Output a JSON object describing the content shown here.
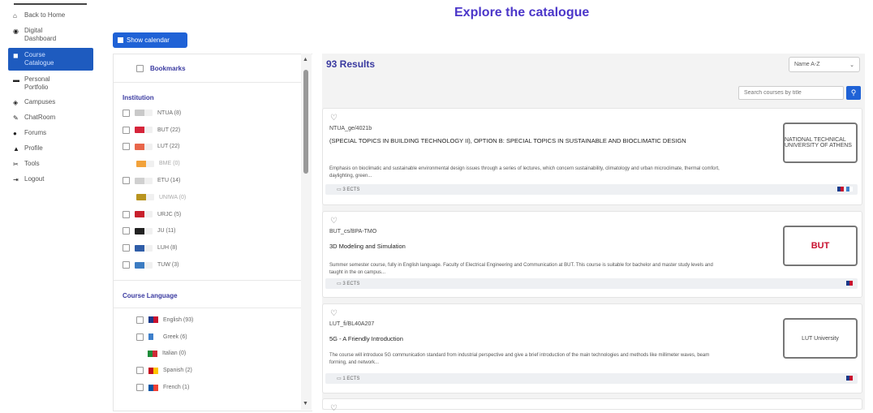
{
  "sidebar": {
    "items": [
      {
        "icon": "home-icon",
        "glyph": "⌂",
        "label": "Back to Home"
      },
      {
        "icon": "dashboard-icon",
        "glyph": "◉",
        "label": "Digital Dashboard"
      },
      {
        "icon": "catalogue-icon",
        "glyph": "◼",
        "label": "Course Catalogue"
      },
      {
        "icon": "portfolio-icon",
        "glyph": "▬",
        "label": "Personal Portfolio"
      },
      {
        "icon": "campuses-icon",
        "glyph": "◈",
        "label": "Campuses"
      },
      {
        "icon": "chatroom-icon",
        "glyph": "✎",
        "label": "ChatRoom"
      },
      {
        "icon": "forums-icon",
        "glyph": "●",
        "label": "Forums"
      },
      {
        "icon": "profile-icon",
        "glyph": "▲",
        "label": "Profile"
      },
      {
        "icon": "tools-icon",
        "glyph": "✂",
        "label": "Tools"
      },
      {
        "icon": "logout-icon",
        "glyph": "⇥",
        "label": "Logout"
      }
    ]
  },
  "page": {
    "title": "Explore the catalogue"
  },
  "calendar_button": "Show calendar",
  "filters": {
    "bookmarks_label": "Bookmarks",
    "institution_heading": "Institution",
    "institutions": [
      {
        "label": "NTUA (8)",
        "color": "#c9c9c9",
        "checkbox": true
      },
      {
        "label": "BUT (22)",
        "color": "#d6243a",
        "checkbox": true
      },
      {
        "label": "LUT (22)",
        "color": "#e8664a",
        "checkbox": true
      },
      {
        "label": "BME (0)",
        "color": "#f2a23b",
        "checkbox": false
      },
      {
        "label": "ETU (14)",
        "color": "#d0d0d0",
        "checkbox": true
      },
      {
        "label": "UNIWA (0)",
        "color": "#b8941f",
        "checkbox": false
      },
      {
        "label": "URJC (5)",
        "color": "#c8202c",
        "checkbox": true
      },
      {
        "label": "JU (11)",
        "color": "#222222",
        "checkbox": true
      },
      {
        "label": "LUH (8)",
        "color": "#2f5da8",
        "checkbox": true
      },
      {
        "label": "TUW (3)",
        "color": "#3c7cc2",
        "checkbox": true
      }
    ],
    "language_heading": "Course Language",
    "languages": [
      {
        "label": "English (93)",
        "colors": [
          "#1a3a8a",
          "#c8102e"
        ],
        "checkbox": true
      },
      {
        "label": "Greek (6)",
        "colors": [
          "#3d7fcb",
          "#ffffff"
        ],
        "checkbox": true
      },
      {
        "label": "Italian (0)",
        "colors": [
          "#1e8c3a",
          "#ce2b37"
        ],
        "checkbox": false
      },
      {
        "label": "Spanish (2)",
        "colors": [
          "#c60b1e",
          "#ffc400"
        ],
        "checkbox": true
      },
      {
        "label": "French (1)",
        "colors": [
          "#0055a4",
          "#ef4135"
        ],
        "checkbox": true
      }
    ]
  },
  "results": {
    "count_label": "93 Results",
    "sort_value": "Name A-Z",
    "search_placeholder": "Search courses by title"
  },
  "courses": [
    {
      "code": "NTUA_ge/4021b",
      "title": "(SPECIAL TOPICS IN BUILDING TECHNOLOGY II), OPTION B: SPECIAL TOPICS IN SUSTAINABLE AND BIOCLIMATIC DESIGN",
      "description": "Emphasis on bioclimatic and sustainable environmental design issues through a series of lectures, which concern sustainability, climatology and urban microclimate, thermal comfort, daylighting, green...",
      "ects": "3 ECTS",
      "institution_logo": "NATIONAL TECHNICAL UNIVERSITY OF ATHENS",
      "flags": [
        [
          "#1a3a8a",
          "#c8102e"
        ],
        [
          "#3d7fcb",
          "#ffffff"
        ]
      ]
    },
    {
      "code": "BUT_cs/BPA-TMO",
      "title": "3D Modeling and Simulation",
      "description": "Summer semester course, fully in English language. Faculty of Electrical Engineering and Communication at BUT. This course is suitable for bachelor and master study levels and taught in the on campus...",
      "ects": "3 ECTS",
      "institution_logo": "BUT",
      "flags": [
        [
          "#1a3a8a",
          "#c8102e"
        ]
      ]
    },
    {
      "code": "LUT_fi/BL40A207",
      "title": "5G - A Friendly Introduction",
      "description": "The course will introduce 5G communication standard from industrial perspective and give a brief introduction of the main technologies and methods like millimeter waves, beam forming, and network...",
      "ects": "1 ECTS",
      "institution_logo": "LUT University",
      "flags": [
        [
          "#1a3a8a",
          "#c8102e"
        ]
      ]
    }
  ]
}
